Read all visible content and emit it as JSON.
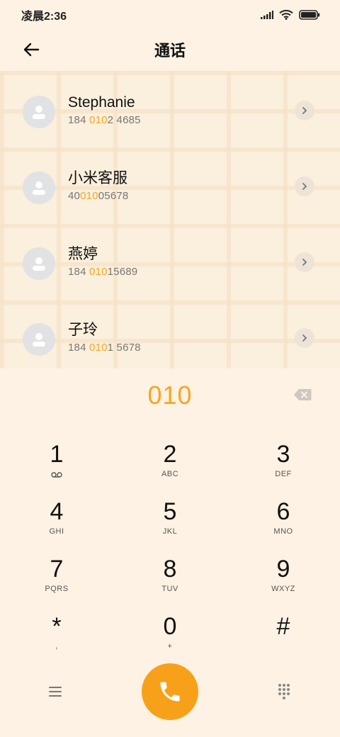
{
  "colors": {
    "accent": "#F5A623",
    "background": "#FDF2E3",
    "avatar": "#E1E2E4"
  },
  "status_bar": {
    "time": "凌晨2:36",
    "icons": [
      "signal-icon",
      "wifi-icon",
      "battery-icon"
    ]
  },
  "header": {
    "title": "通话",
    "back_icon": "back-arrow-icon"
  },
  "contacts": [
    {
      "name": "Stephanie",
      "number_pre": "184 ",
      "number_match": "010",
      "number_post": "2 4685"
    },
    {
      "name": "小米客服",
      "number_pre": "40",
      "number_match": "010",
      "number_post": "05678"
    },
    {
      "name": "燕婷",
      "number_pre": "184 ",
      "number_match": "010",
      "number_post": "15689"
    },
    {
      "name": "子玲",
      "number_pre": "184 ",
      "number_match": "010",
      "number_post": "1 5678"
    }
  ],
  "dialer": {
    "input": "010"
  },
  "keypad": [
    {
      "digit": "1",
      "letters": ""
    },
    {
      "digit": "2",
      "letters": "ABC"
    },
    {
      "digit": "3",
      "letters": "DEF"
    },
    {
      "digit": "4",
      "letters": "GHI"
    },
    {
      "digit": "5",
      "letters": "JKL"
    },
    {
      "digit": "6",
      "letters": "MNO"
    },
    {
      "digit": "7",
      "letters": "PQRS"
    },
    {
      "digit": "8",
      "letters": "TUV"
    },
    {
      "digit": "9",
      "letters": "WXYZ"
    },
    {
      "digit": "*",
      "letters": ","
    },
    {
      "digit": "0",
      "letters": "+"
    },
    {
      "digit": "#",
      "letters": ""
    }
  ],
  "bottom_bar": {
    "icons": [
      "menu-icon",
      "phone-icon",
      "dialpad-icon"
    ]
  }
}
